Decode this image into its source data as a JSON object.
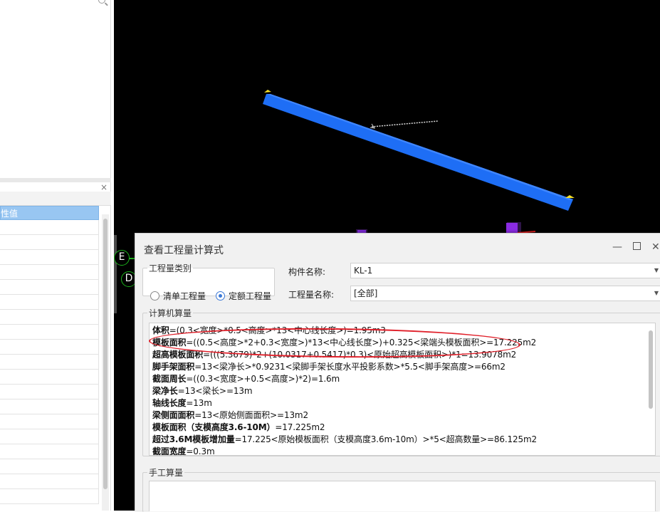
{
  "dialog": {
    "title": "查看工程量计算式",
    "quantity_type_group": {
      "legend": "工程量类别",
      "options": [
        {
          "label": "清单工程量",
          "selected": false
        },
        {
          "label": "定额工程量",
          "selected": true
        }
      ]
    },
    "component_name": {
      "label": "构件名称:",
      "value": "KL-1"
    },
    "quantity_name": {
      "label": "工程量名称:",
      "value": "[全部]"
    },
    "computer_calc": {
      "legend": "计算机算量",
      "lines": [
        {
          "name": "体积",
          "expr": "=(0.3<宽度>*0.5<高度>*13<中心线长度>)=1.95m3"
        },
        {
          "name": "模板面积",
          "expr": "=((0.5<高度>*2+0.3<宽度>)*13<中心线长度>)+0.325<梁端头模板面积>=17.225m2"
        },
        {
          "name": "超高模板面积",
          "expr": "=(((5.3679)*2+(10.0317+0.5417)*0.3)<原始超高模板面积>)*1=13.9078m2"
        },
        {
          "name": "脚手架面积",
          "expr": "=13<梁净长>*0.9231<梁脚手架长度水平投影系数>*5.5<脚手架高度>=66m2"
        },
        {
          "name": "截面周长",
          "expr": "=((0.3<宽度>+0.5<高度>)*2)=1.6m"
        },
        {
          "name": "梁净长",
          "expr": "=13<梁长>=13m"
        },
        {
          "name": "轴线长度",
          "expr": "=13m"
        },
        {
          "name": "梁侧面面积",
          "expr": "=13<原始侧面面积>=13m2"
        },
        {
          "name": "模板面积（支模高度3.6-10M）",
          "expr": "=17.225m2"
        },
        {
          "name": "超过3.6M模板增加量",
          "expr": "=17.225<原始模板面积（支模高度3.6m-10m）>*5<超高数量>=86.125m2"
        },
        {
          "name": "截面宽度",
          "expr": "=0.3m"
        }
      ]
    },
    "manual_calc": {
      "legend": "手工算量"
    }
  },
  "left_panel": {
    "property_header": "性值"
  },
  "viewport": {
    "axis_labels": [
      "E",
      "D"
    ],
    "beam_color": "#1e6ef5"
  },
  "colors": {
    "highlight_ellipse": "#e0202a",
    "axis_green": "#1db41d",
    "prop_header_blue": "#98c6f2"
  }
}
